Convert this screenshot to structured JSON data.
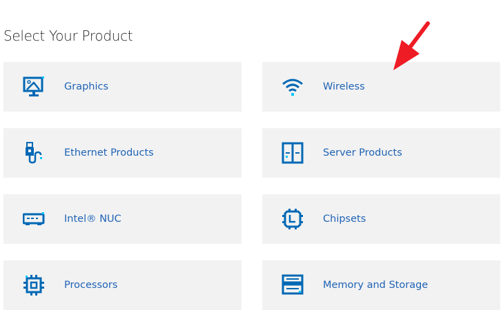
{
  "page_title": "Select Your Product",
  "products": [
    {
      "label": "Graphics",
      "icon": "monitor-image-icon"
    },
    {
      "label": "Wireless",
      "icon": "wifi-icon"
    },
    {
      "label": "Ethernet Products",
      "icon": "ethernet-cable-icon"
    },
    {
      "label": "Server Products",
      "icon": "server-icon"
    },
    {
      "label": "Intel® NUC",
      "icon": "nuc-box-icon"
    },
    {
      "label": "Chipsets",
      "icon": "chipset-icon"
    },
    {
      "label": "Processors",
      "icon": "processor-icon"
    },
    {
      "label": "Memory and Storage",
      "icon": "memory-storage-icon"
    }
  ],
  "colors": {
    "icon": "#0068b5",
    "accent": "#00c7fd",
    "link": "#1f63b5",
    "card": "#f2f2f2",
    "annotation_arrow": "#ee1c25"
  }
}
